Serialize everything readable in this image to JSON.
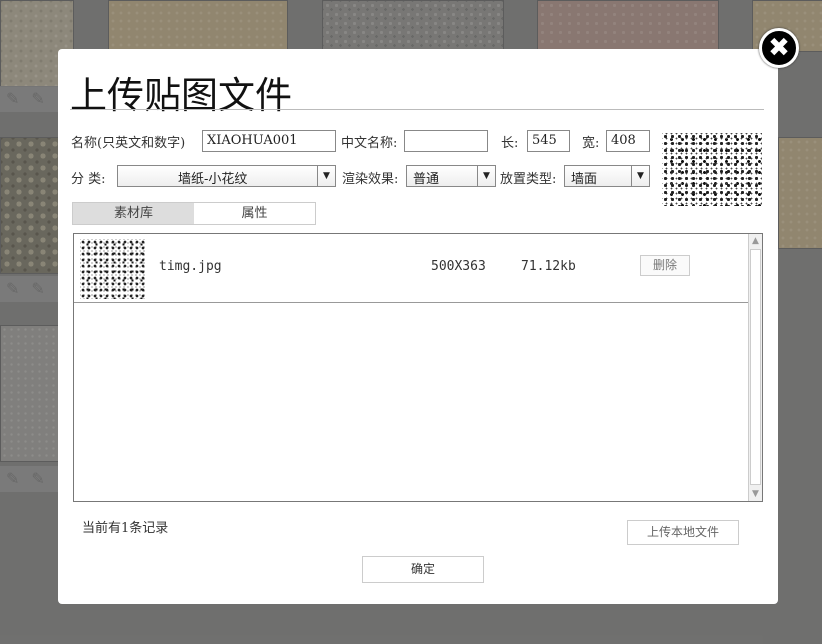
{
  "dialog": {
    "title": "上传贴图文件",
    "close_label": "✖"
  },
  "form": {
    "name_label": "名称(只英文和数字)",
    "name_value": "XIAOHUA001",
    "cn_name_label": "中文名称:",
    "cn_name_value": "",
    "length_label": "长:",
    "length_value": "545",
    "width_label": "宽:",
    "width_value": "408",
    "category_label": "分 类:",
    "category_value": "墙纸-小花纹",
    "render_label": "渲染效果:",
    "render_value": "普通",
    "placement_label": "放置类型:",
    "placement_value": "墙面"
  },
  "tabs": [
    "素材库",
    "属性"
  ],
  "files": [
    {
      "name": "timg.jpg",
      "dimensions": "500X363",
      "size": "71.12kb",
      "delete_label": "删除"
    }
  ],
  "footer": {
    "record_count": "当前有1条记录",
    "upload_label": "上传本地文件",
    "confirm_label": "确定"
  },
  "icons": {
    "scroll_up": "▲",
    "scroll_down": "▼",
    "dropdown": "▼"
  }
}
